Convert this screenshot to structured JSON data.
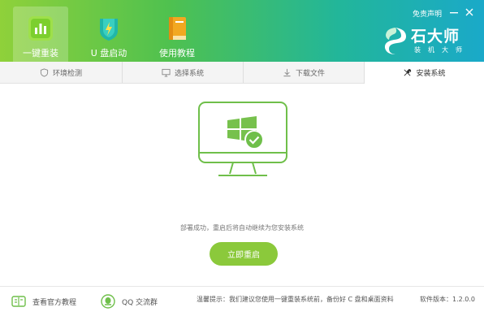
{
  "header": {
    "nav": [
      {
        "label": "一键重装",
        "icon": "bar-chart-icon"
      },
      {
        "label": "U 盘启动",
        "icon": "usb-shield-icon"
      },
      {
        "label": "使用教程",
        "icon": "book-icon"
      }
    ],
    "disclaimer": "免责声明",
    "brand": {
      "name": "石大师",
      "sub": "装机大师"
    }
  },
  "steps": [
    {
      "label": "环境检测",
      "icon": "shield-icon"
    },
    {
      "label": "选择系统",
      "icon": "monitor-icon"
    },
    {
      "label": "下载文件",
      "icon": "download-icon"
    },
    {
      "label": "安装系统",
      "icon": "wrench-icon",
      "active": true
    }
  ],
  "main": {
    "status": "部署成功，重启后将自动继续为您安装系统",
    "restart_label": "立即重启"
  },
  "footer": {
    "tutorial_label": "查看官方教程",
    "qq_label": "QQ 交流群",
    "tip": "温馨提示：我们建议您使用一键重装系统前，备份好 C 盘和桌面资料",
    "version": "软件版本：1.2.0.0"
  },
  "colors": {
    "accent_green": "#8bc93b",
    "header_start": "#8fd13a",
    "header_end": "#1aa9c9",
    "monitor_stroke": "#6fbf4a"
  }
}
